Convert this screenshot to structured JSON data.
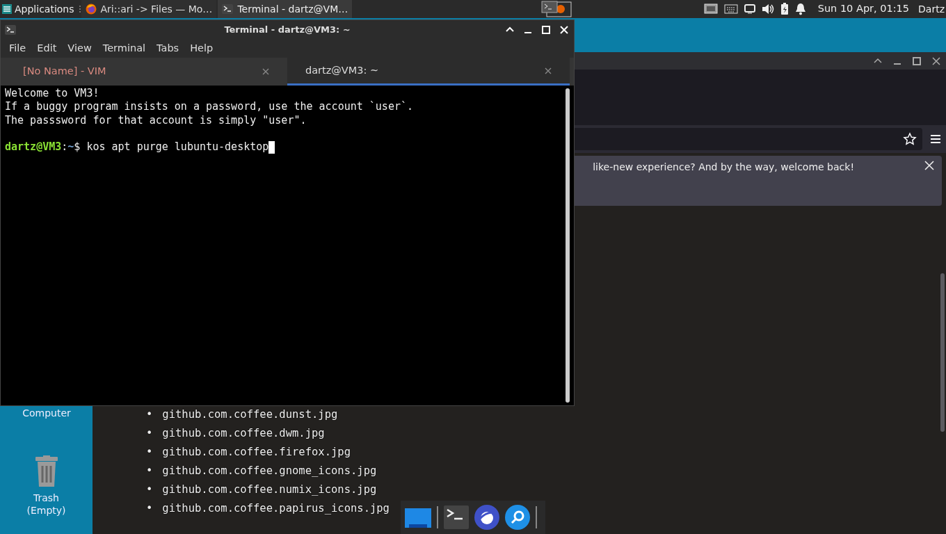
{
  "panel": {
    "menu": "Applications",
    "tasks": [
      {
        "title": "Ari::ari -> Files — Mo…",
        "kind": "browser",
        "selected": false
      },
      {
        "title": "Terminal - dartz@VM…",
        "kind": "terminal",
        "selected": true
      }
    ],
    "clock": "Sun 10 Apr, 01:15",
    "user": "Dartz"
  },
  "desktop_icons": [
    {
      "label": "Computer",
      "kind": "computer"
    },
    {
      "label": "Trash (Empty)",
      "kind": "trash"
    }
  ],
  "browser": {
    "notification": "like-new experience? And by the way, welcome back!",
    "files": [
      {
        "bullet": "•",
        "name": "github.com.coffee.dunst.jpg"
      },
      {
        "bullet": "•",
        "name": "github.com.coffee.dwm.jpg"
      },
      {
        "bullet": "•",
        "name": "github.com.coffee.firefox.jpg"
      },
      {
        "bullet": "•",
        "name": "github.com.coffee.gnome_icons.jpg"
      },
      {
        "bullet": "•",
        "name": "github.com.coffee.numix_icons.jpg"
      },
      {
        "bullet": "•",
        "name": "github.com.coffee.papirus_icons.jpg"
      }
    ]
  },
  "terminal": {
    "title": "Terminal - dartz@VM3: ~",
    "menu": [
      "File",
      "Edit",
      "View",
      "Terminal",
      "Tabs",
      "Help"
    ],
    "tabs": [
      {
        "label": "[No Name] - VIM",
        "selected": false
      },
      {
        "label": "dartz@VM3: ~",
        "selected": true
      }
    ],
    "lines": [
      "Welcome to VM3!",
      "If a buggy program insists on a password, use the account `user`.",
      "The passsword for that account is simply \"user\"."
    ],
    "prompt": {
      "user_host": "dartz@VM3",
      "separator": ":",
      "path": "~",
      "symbol": "$",
      "command": "kos apt purge lubuntu-desktop"
    }
  },
  "dock": [
    {
      "kind": "files"
    },
    {
      "kind": "terminal"
    },
    {
      "kind": "browser"
    },
    {
      "kind": "search"
    }
  ]
}
